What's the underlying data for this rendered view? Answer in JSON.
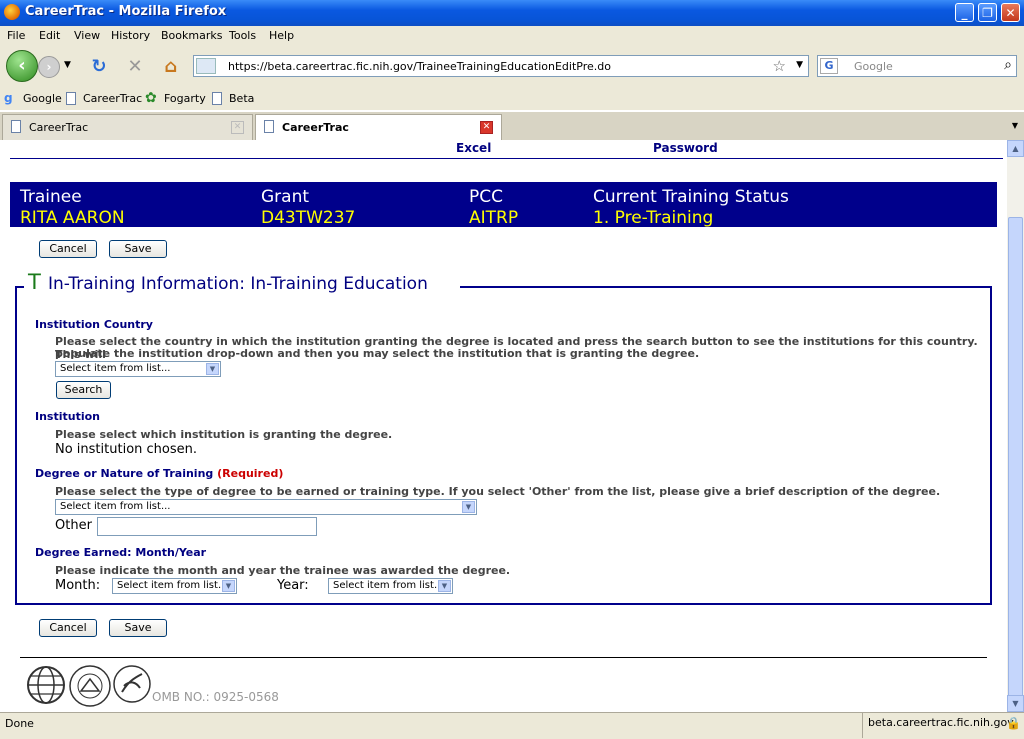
{
  "window": {
    "title": "CareerTrac - Mozilla Firefox"
  },
  "menu": [
    "File",
    "Edit",
    "View",
    "History",
    "Bookmarks",
    "Tools",
    "Help"
  ],
  "navbar": {
    "url": "https://beta.careertrac.fic.nih.gov/TraineeTrainingEducationEditPre.do",
    "search_placeholder": "Google"
  },
  "bookmarks": [
    "Google",
    "CareerTrac",
    "Fogarty",
    "Beta"
  ],
  "tabs": [
    {
      "label": "CareerTrac",
      "active": false
    },
    {
      "label": "CareerTrac",
      "active": true
    }
  ],
  "top_links": {
    "excel": "Excel",
    "password": "Password"
  },
  "banner": {
    "headers": [
      "Trainee",
      "Grant",
      "PCC",
      "Current Training Status"
    ],
    "values": [
      "RITA AARON",
      "D43TW237",
      "AITRP",
      "1. Pre-Training"
    ]
  },
  "buttons": {
    "cancel": "Cancel",
    "save": "Save",
    "search": "Search"
  },
  "section": {
    "letter": "T",
    "title": "In-Training Information: In-Training Education"
  },
  "form": {
    "country": {
      "label": "Institution Country",
      "desc1": "Please select the country in which the institution granting the degree is located and press the search button to see the institutions for this country. This will",
      "desc2": "populate the institution drop-down and then you may select the institution that is granting the degree.",
      "select": "Select item from list..."
    },
    "institution": {
      "label": "Institution",
      "desc": "Please select which institution is granting the degree.",
      "value": "No institution chosen."
    },
    "degree": {
      "label": "Degree or Nature of Training",
      "required": "(Required)",
      "desc": "Please select the type of degree to be earned or training type. If you select 'Other' from the list, please give a brief description of the degree.",
      "select": "Select item from list...",
      "other_label": "Other",
      "other_value": ""
    },
    "earned": {
      "label": "Degree Earned: Month/Year",
      "desc": "Please indicate the month and year the trainee was awarded the degree.",
      "month_label": "Month:",
      "month_select": "Select item from list...",
      "year_label": "Year:",
      "year_select": "Select item from list..."
    }
  },
  "footer": {
    "omb": "OMB NO.: 0925-0568"
  },
  "status": {
    "text": "Done",
    "host": "beta.careertrac.fic.nih.gov"
  }
}
